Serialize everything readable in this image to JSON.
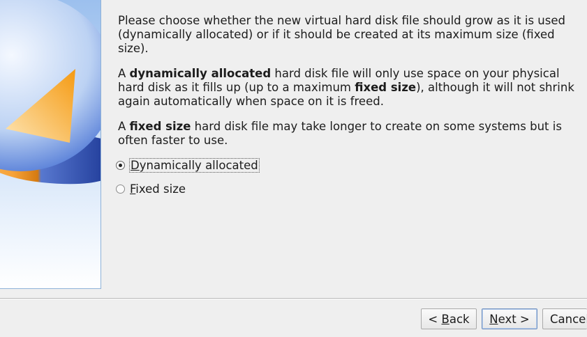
{
  "description": {
    "p1": "Please choose whether the new virtual hard disk file should grow as it is used (dynamically allocated) or if it should be created at its maximum size (fixed size).",
    "p2_pre": "A ",
    "p2_bold1": "dynamically allocated",
    "p2_mid": " hard disk file will only use space on your physical hard disk as it fills up (up to a maximum ",
    "p2_bold2": "fixed size",
    "p2_post": "), although it will not shrink again automatically when space on it is freed.",
    "p3_pre": "A ",
    "p3_bold": "fixed size",
    "p3_post": " hard disk file may take longer to create on some systems but is often faster to use."
  },
  "options": {
    "dynamic": {
      "mnemonic": "D",
      "rest": "ynamically allocated",
      "selected": true
    },
    "fixed": {
      "mnemonic": "F",
      "rest": "ixed size",
      "selected": false
    }
  },
  "buttons": {
    "back": {
      "pre": "< ",
      "mnemonic": "B",
      "rest": "ack"
    },
    "next": {
      "mnemonic": "N",
      "rest": "ext >"
    },
    "cancel": {
      "label": "Cancel"
    }
  },
  "colors": {
    "disk_blue": "#3d63c9",
    "disk_orange": "#f39a1c",
    "dialog_bg": "#efefef"
  }
}
